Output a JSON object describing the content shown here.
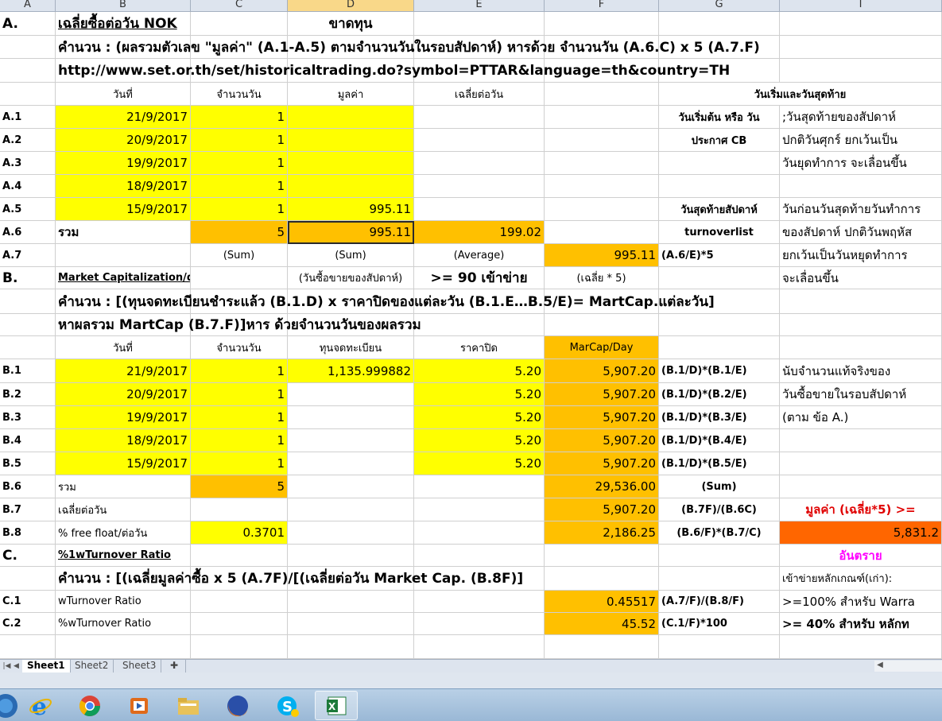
{
  "columns": [
    "A",
    "B",
    "C",
    "D",
    "E",
    "F",
    "G",
    "I"
  ],
  "selected_column": "D",
  "rows": {
    "r1": {
      "a": "A.",
      "b": "เฉลี่ยซื้อต่อวัน NOK",
      "d": "ขาดทุน"
    },
    "r2": {
      "b": "คำนวน : (ผลรวมตัวเลข \"มูลค่า\" (A.1-A.5) ตามจำนวนวันในรอบสัปดาห์) หารด้วย จำนวนวัน (A.6.C) x 5 (A.7.F)"
    },
    "r3": {
      "b": "http://www.set.or.th/set/historicaltrading.do?symbol=PTTAR&language=th&country=TH"
    },
    "r4": {
      "b": "วันที่",
      "c": "จำนวนวัน",
      "d": "มูลค่า",
      "e": "เฉลี่ยต่อวัน",
      "gi": "วันเริ่มและวันสุดท้าย"
    },
    "a1": {
      "a": "A.1",
      "b": "21/9/2017",
      "c": "1",
      "g": "วันเริ่มต้น หรือ วัน",
      "i": ";วันสุดท้ายของสัปดาห์"
    },
    "a2": {
      "a": "A.2",
      "b": "20/9/2017",
      "c": "1",
      "g": "ประกาศ CB",
      "i": "ปกติวันศุกร์ ยกเว้นเป็น"
    },
    "a3": {
      "a": "A.3",
      "b": "19/9/2017",
      "c": "1",
      "i": "วันยุดทำการ จะเลื่อนขึ้น"
    },
    "a4": {
      "a": "A.4",
      "b": "18/9/2017",
      "c": "1"
    },
    "a5": {
      "a": "A.5",
      "b": "15/9/2017",
      "c": "1",
      "d": "995.11",
      "g": "วันสุดท้ายสัปดาห์",
      "i": "วันก่อนวันสุดท้ายวันทำการ"
    },
    "a6": {
      "a": "A.6",
      "b": "รวม",
      "c": "5",
      "d": "995.11",
      "e": "199.02",
      "g": "turnoverlist",
      "i": "ของสัปดาห์ ปกติวันพฤหัส"
    },
    "a7": {
      "a": "A.7",
      "c": "(Sum)",
      "d": "(Sum)",
      "e": "(Average)",
      "f": "995.11",
      "g": "(A.6/E)*5",
      "i": "ยกเว้นเป็นวันหยุดทำการ"
    },
    "b0": {
      "a": "B.",
      "b": "Market Capitalization/day",
      "d": "(วันซื้อขายของสัปดาห์)",
      "e": ">= 90 เข้าข่าย",
      "f": "(เฉลี่ย * 5)",
      "i": "จะเลื่อนขึ้น"
    },
    "r12": {
      "b": "คำนวน :  [(ทุนจดทะเบียนชำระแล้ว (B.1.D) x ราคาปิดของแต่ละวัน (B.1.E…B.5/E)= MartCap.แต่ละวัน]"
    },
    "r13": {
      "b": "หาผลรวม MartCap (B.7.F)]หาร ด้วยจำนวนวันของผลรวม"
    },
    "r14": {
      "b": "วันที่",
      "c": "จำนวนวัน",
      "d": "ทุนจดทะเบียน",
      "e": "ราคาปิด",
      "f": "MarCap/Day"
    },
    "b1": {
      "a": "B.1",
      "b": "21/9/2017",
      "c": "1",
      "d": "1,135.999882",
      "e": "5.20",
      "f": "5,907.20",
      "g": "(B.1/D)*(B.1/E)",
      "i": "นับจำนวนแท้จริงของ"
    },
    "b2": {
      "a": "B.2",
      "b": "20/9/2017",
      "c": "1",
      "e": "5.20",
      "f": "5,907.20",
      "g": "(B.1/D)*(B.2/E)",
      "i": "วันซื้อขายในรอบสัปดาห์"
    },
    "b3": {
      "a": "B.3",
      "b": "19/9/2017",
      "c": "1",
      "e": "5.20",
      "f": "5,907.20",
      "g": "(B.1/D)*(B.3/E)",
      "i": "(ตาม ข้อ A.)"
    },
    "b4": {
      "a": "B.4",
      "b": "18/9/2017",
      "c": "1",
      "e": "5.20",
      "f": "5,907.20",
      "g": "(B.1/D)*(B.4/E)"
    },
    "b5": {
      "a": "B.5",
      "b": "15/9/2017",
      "c": "1",
      "e": "5.20",
      "f": "5,907.20",
      "g": "(B.1/D)*(B.5/E)"
    },
    "b6": {
      "a": "B.6",
      "b": "รวม",
      "c": "5",
      "f": "29,536.00",
      "g": "(Sum)"
    },
    "b7": {
      "a": "B.7",
      "b": "เฉลี่ยต่อวัน",
      "f": "5,907.20",
      "g": "(B.7F)/(B.6C)",
      "i": "มูลค่า (เฉลี่ย*5) >="
    },
    "b8": {
      "a": "B.8",
      "b": "% free float/ต่อวัน",
      "c": "0.3701",
      "f": "2,186.25",
      "g": "(B.6/F)*(B.7/C)",
      "i": "5,831.2"
    },
    "c0": {
      "a": "C.",
      "b": "%1wTurnover Ratio",
      "i": "อันตราย"
    },
    "r24": {
      "b": "คำนวน :  [(เฉลี่ยมูลค่าซื้อ x 5  (A.7F)/[(เฉลี่ยต่อวัน Market Cap. (B.8F)]",
      "i": "เข้าข่ายหลักเกณฑ์(เก่า):"
    },
    "c1": {
      "a": "C.1",
      "b": "wTurnover Ratio",
      "f": "0.45517",
      "g": "(A.7/F)/(B.8/F)",
      "i": ">=100% สำหรับ Warra"
    },
    "c2": {
      "a": "C.2",
      "b": " %wTurnover Ratio",
      "f": "45.52",
      "g": "(C.1/F)*100",
      "i": ">= 40% สำหรับ หลักท"
    }
  },
  "sheet_tabs": [
    "Sheet1",
    "Sheet2",
    "Sheet3"
  ],
  "active_tab": "Sheet1",
  "taskbar": [
    "windows-start",
    "internet-explorer",
    "chrome",
    "media-player",
    "file-explorer",
    "firefox",
    "skype",
    "excel"
  ],
  "colors": {
    "yellow": "#ffff00",
    "orange": "#ffc000",
    "dark_orange": "#ff6600",
    "red_text": "#e00000",
    "magenta_text": "#ff00ff"
  }
}
